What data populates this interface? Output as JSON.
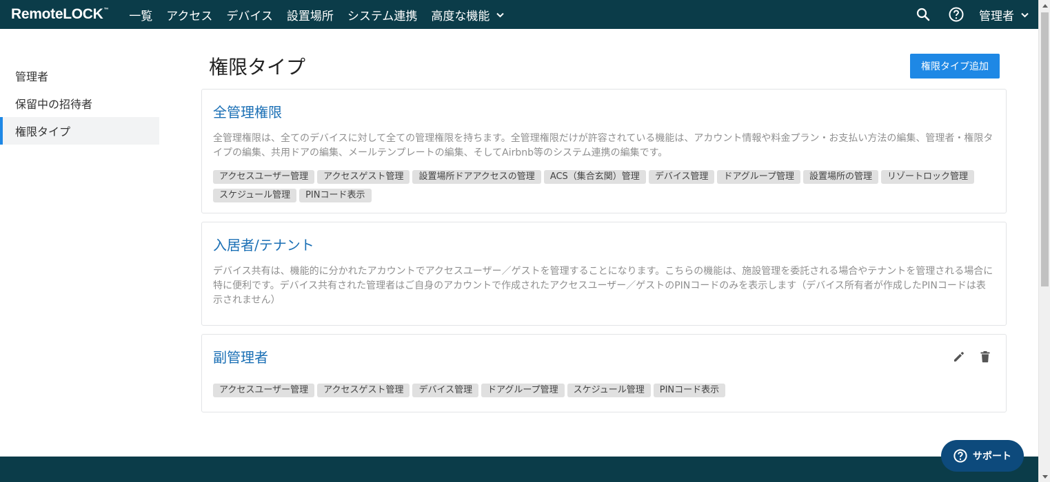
{
  "header": {
    "logo_left": "Remote",
    "logo_right": "LOCK",
    "logo_tm": "™",
    "nav": [
      {
        "label": "一覧"
      },
      {
        "label": "アクセス"
      },
      {
        "label": "デバイス"
      },
      {
        "label": "設置場所"
      },
      {
        "label": "システム連携"
      },
      {
        "label": "高度な機能"
      }
    ],
    "search_icon": "search-icon",
    "help_icon": "help-circle-icon",
    "user_label": "管理者"
  },
  "sidebar": {
    "items": [
      {
        "label": "管理者",
        "active": false
      },
      {
        "label": "保留中の招待者",
        "active": false
      },
      {
        "label": "権限タイプ",
        "active": true
      }
    ]
  },
  "main": {
    "title": "権限タイプ",
    "add_button": "権限タイプ追加",
    "cards": [
      {
        "title": "全管理権限",
        "description": "全管理権限は、全てのデバイスに対して全ての管理権限を持ちます。全管理権限だけが許容されている機能は、アカウント情報や料金プラン・お支払い方法の編集、管理者・権限タイプの編集、共用ドアの編集、メールテンプレートの編集、そしてAirbnb等のシステム連携の編集です。",
        "tags": [
          "アクセスユーザー管理",
          "アクセスゲスト管理",
          "設置場所ドアアクセスの管理",
          "ACS（集合玄関）管理",
          "デバイス管理",
          "ドアグループ管理",
          "設置場所の管理",
          "リゾートロック管理",
          "スケジュール管理",
          "PINコード表示"
        ]
      },
      {
        "title": "入居者/テナント",
        "description": "デバイス共有は、機能的に分かれたアカウントでアクセスユーザー／ゲストを管理することになります。こちらの機能は、施設管理を委託される場合やテナントを管理される場合に特に便利です。デバイス共有された管理者はご自身のアカウントで作成されたアクセスユーザー／ゲストのPINコードのみを表示します（デバイス所有者が作成したPINコードは表示されません）",
        "tags": []
      },
      {
        "title": "副管理者",
        "description": "",
        "tags": [
          "アクセスユーザー管理",
          "アクセスゲスト管理",
          "デバイス管理",
          "ドアグループ管理",
          "スケジュール管理",
          "PINコード表示"
        ],
        "edit_icon": "pencil-icon",
        "delete_icon": "trash-icon"
      }
    ]
  },
  "support": {
    "label": "サポート"
  },
  "colors": {
    "header_bg": "#0b3c49",
    "accent": "#1e88e5",
    "link": "#1a6fb5",
    "tag_bg": "#e0e0e0"
  }
}
